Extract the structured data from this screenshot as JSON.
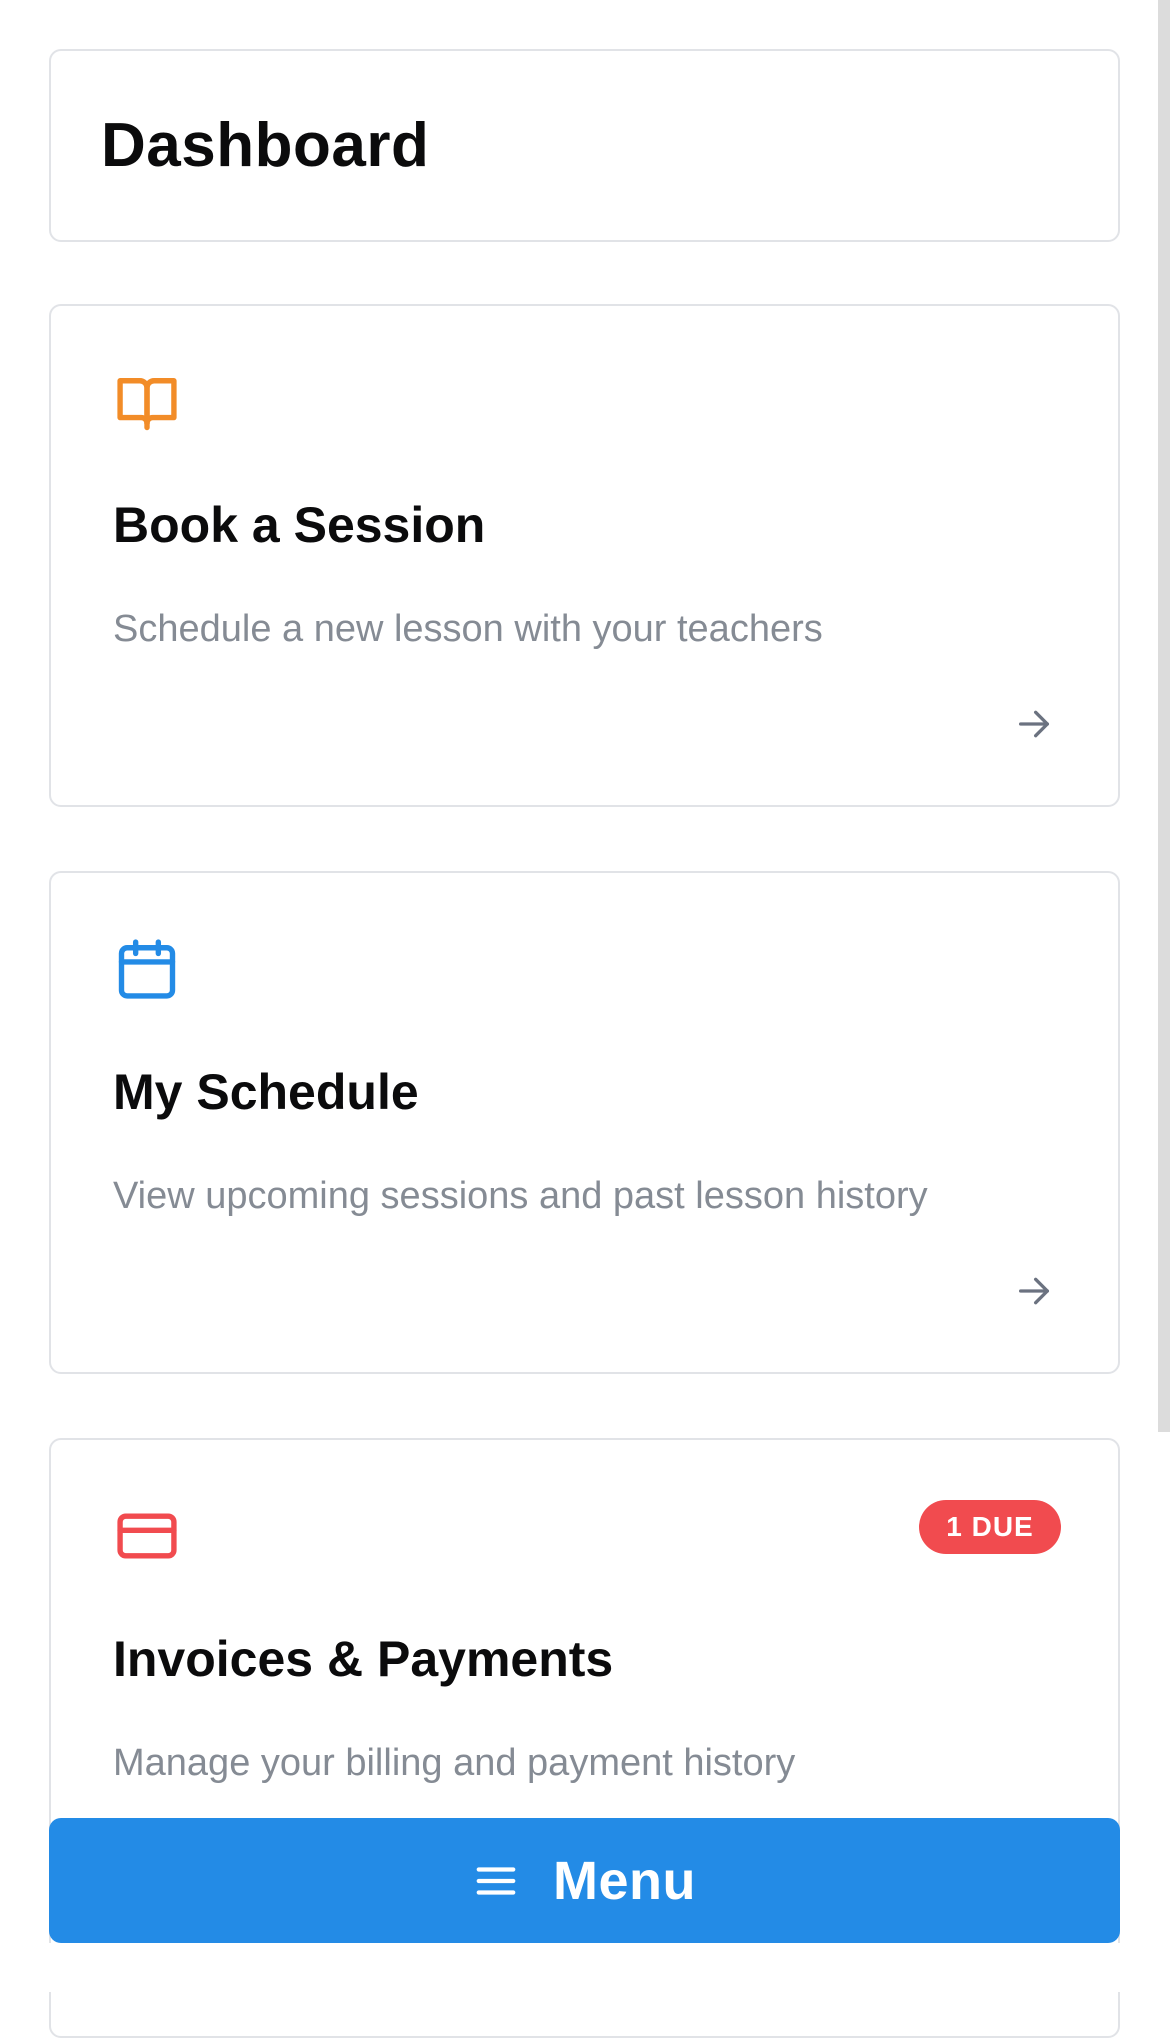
{
  "header": {
    "title": "Dashboard"
  },
  "cards": [
    {
      "icon": "book-open-icon",
      "title": "Book a Session",
      "description": "Schedule a new lesson with your teachers",
      "accent": "#f28c28"
    },
    {
      "icon": "calendar-icon",
      "title": "My Schedule",
      "description": "View upcoming sessions and past lesson history",
      "accent": "#238be6"
    },
    {
      "icon": "credit-card-icon",
      "title": "Invoices & Payments",
      "description": "Manage your billing and payment history",
      "badge": "1 DUE",
      "accent": "#f14b4f"
    }
  ],
  "menu": {
    "label": "Menu",
    "icon": "hamburger-icon",
    "color": "#238be6"
  }
}
